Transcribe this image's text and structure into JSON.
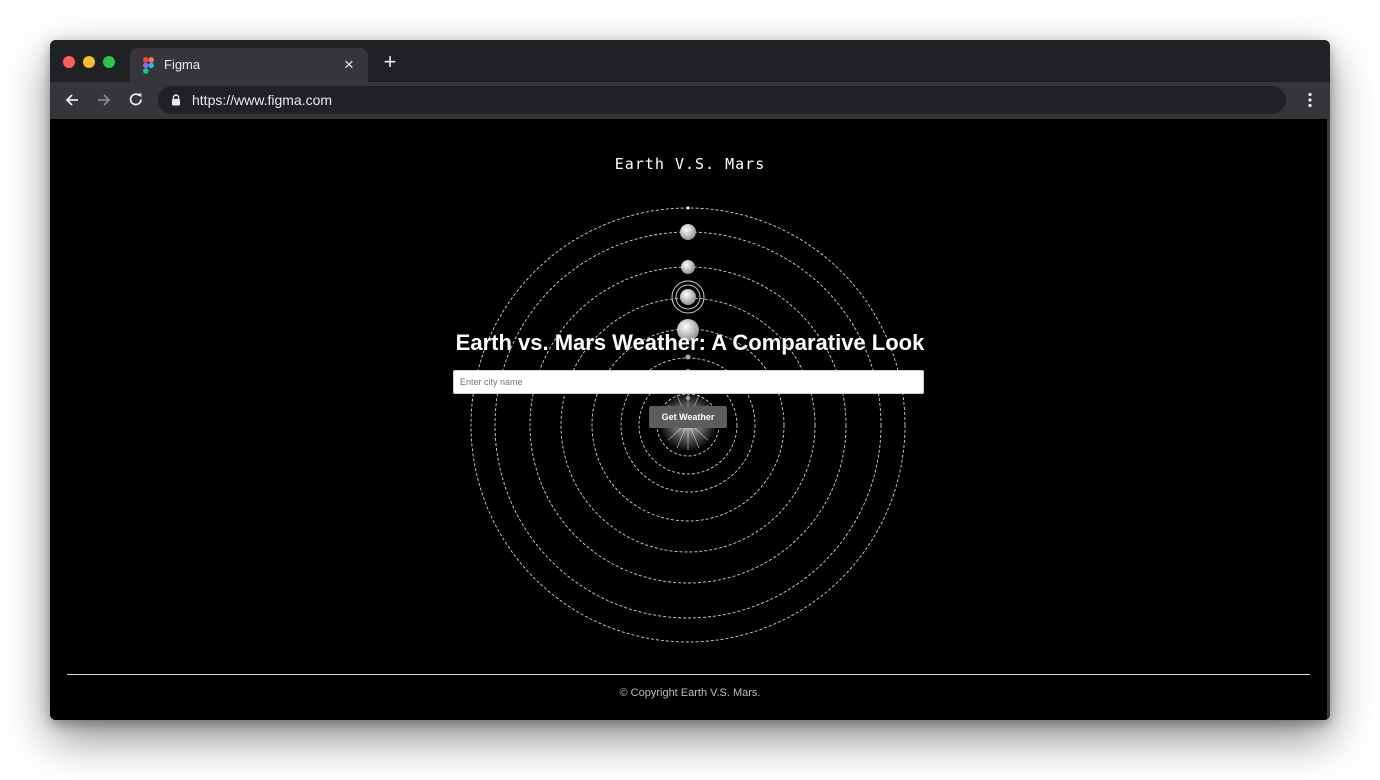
{
  "browser": {
    "tab_title": "Figma",
    "tab_close": "×",
    "new_tab": "+",
    "url": "https://www.figma.com"
  },
  "page": {
    "site_title": "Earth V.S. Mars",
    "headline": "Earth vs. Mars Weather: A Comparative Look",
    "city_input_placeholder": "Enter city name",
    "city_input_value": "",
    "button_label": "Get Weather",
    "copyright": "© Copyright Earth V.S. Mars."
  },
  "colors": {
    "page_background": "#000000",
    "chrome_dark": "#202124",
    "chrome_tab": "#35363a",
    "button": "#5c5c5c",
    "text": "#ffffff"
  },
  "icons": {
    "back": "arrow-left-icon",
    "forward": "arrow-right-icon",
    "reload": "reload-icon",
    "lock": "lock-icon",
    "menu": "kebab-menu-icon",
    "favicon": "figma-icon",
    "sun": "sun-icon"
  }
}
